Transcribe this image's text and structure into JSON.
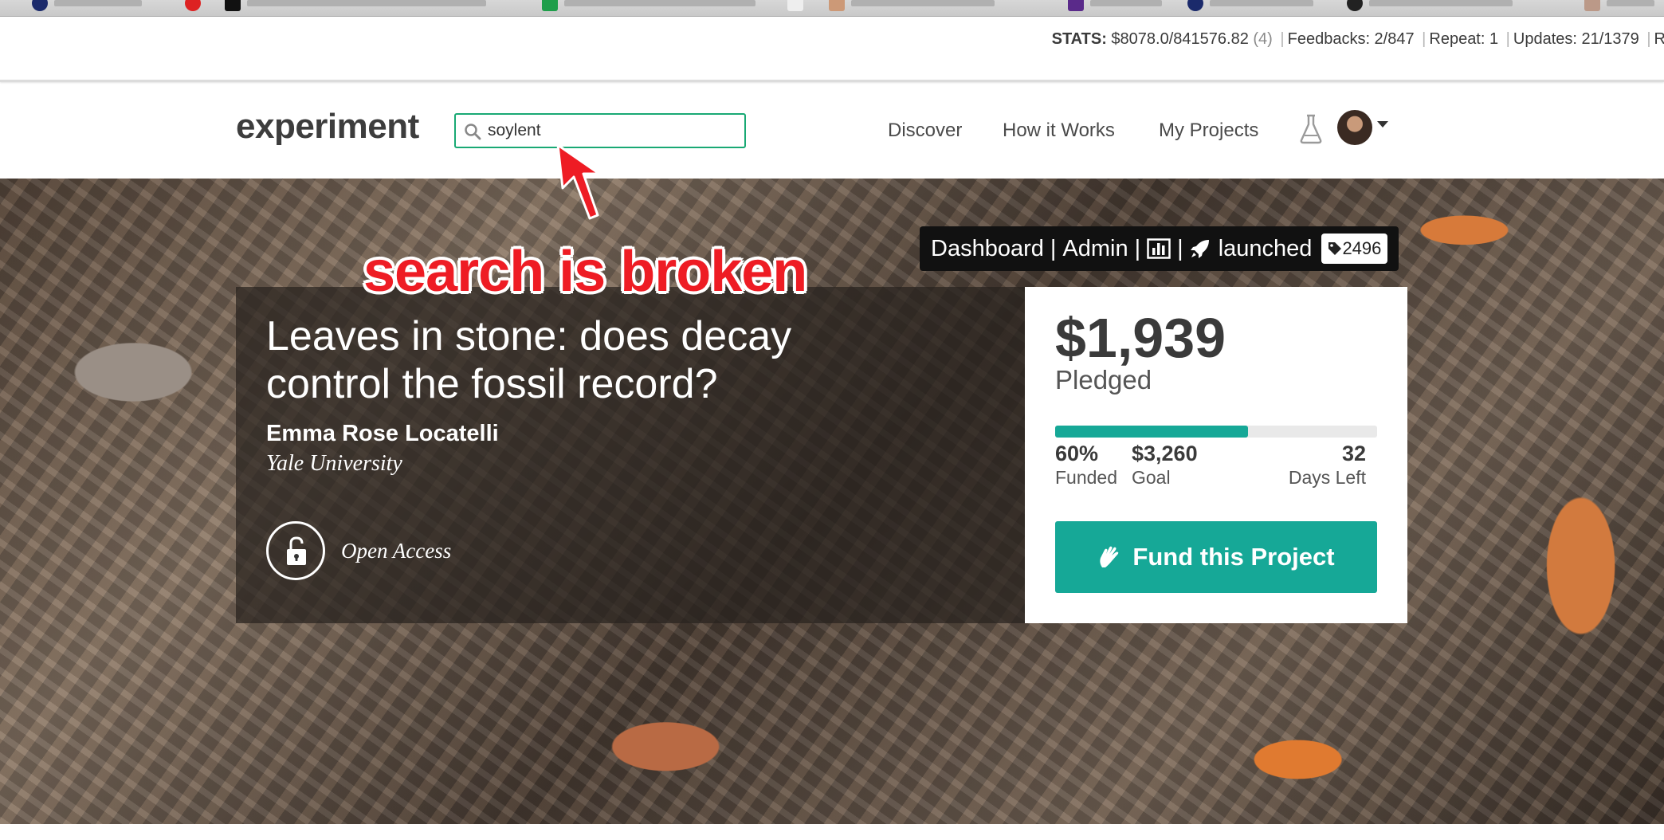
{
  "stats": {
    "label": "STATS:",
    "money": "$8078.0/841576.82",
    "money_count": "(4)",
    "feedbacks": "Feedbacks: 2/847",
    "repeat": "Repeat: 1",
    "updates": "Updates: 21/1379",
    "trailing": "R"
  },
  "header": {
    "logo": "experiment",
    "search_value": "soylent",
    "nav": [
      "Discover",
      "How it Works",
      "My Projects"
    ]
  },
  "project": {
    "title": "Leaves in stone: does decay control the fossil record?",
    "author": "Emma Rose Locatelli",
    "institution": "Yale University",
    "access_label": "Open Access"
  },
  "admin_bar": {
    "dashboard": "Dashboard",
    "admin": "Admin",
    "status": "launched",
    "tag_count": "2496"
  },
  "funding": {
    "amount": "$1,939",
    "amount_label": "Pledged",
    "funded_fraction": 0.6,
    "percent": "60%",
    "percent_label": "Funded",
    "goal": "$3,260",
    "goal_label": "Goal",
    "days": "32",
    "days_label": "Days Left",
    "button": "Fund this Project"
  },
  "annotation": "search is broken",
  "colors": {
    "accent": "#16a897",
    "search_border": "#19a974",
    "annotation": "#ee1c24"
  }
}
